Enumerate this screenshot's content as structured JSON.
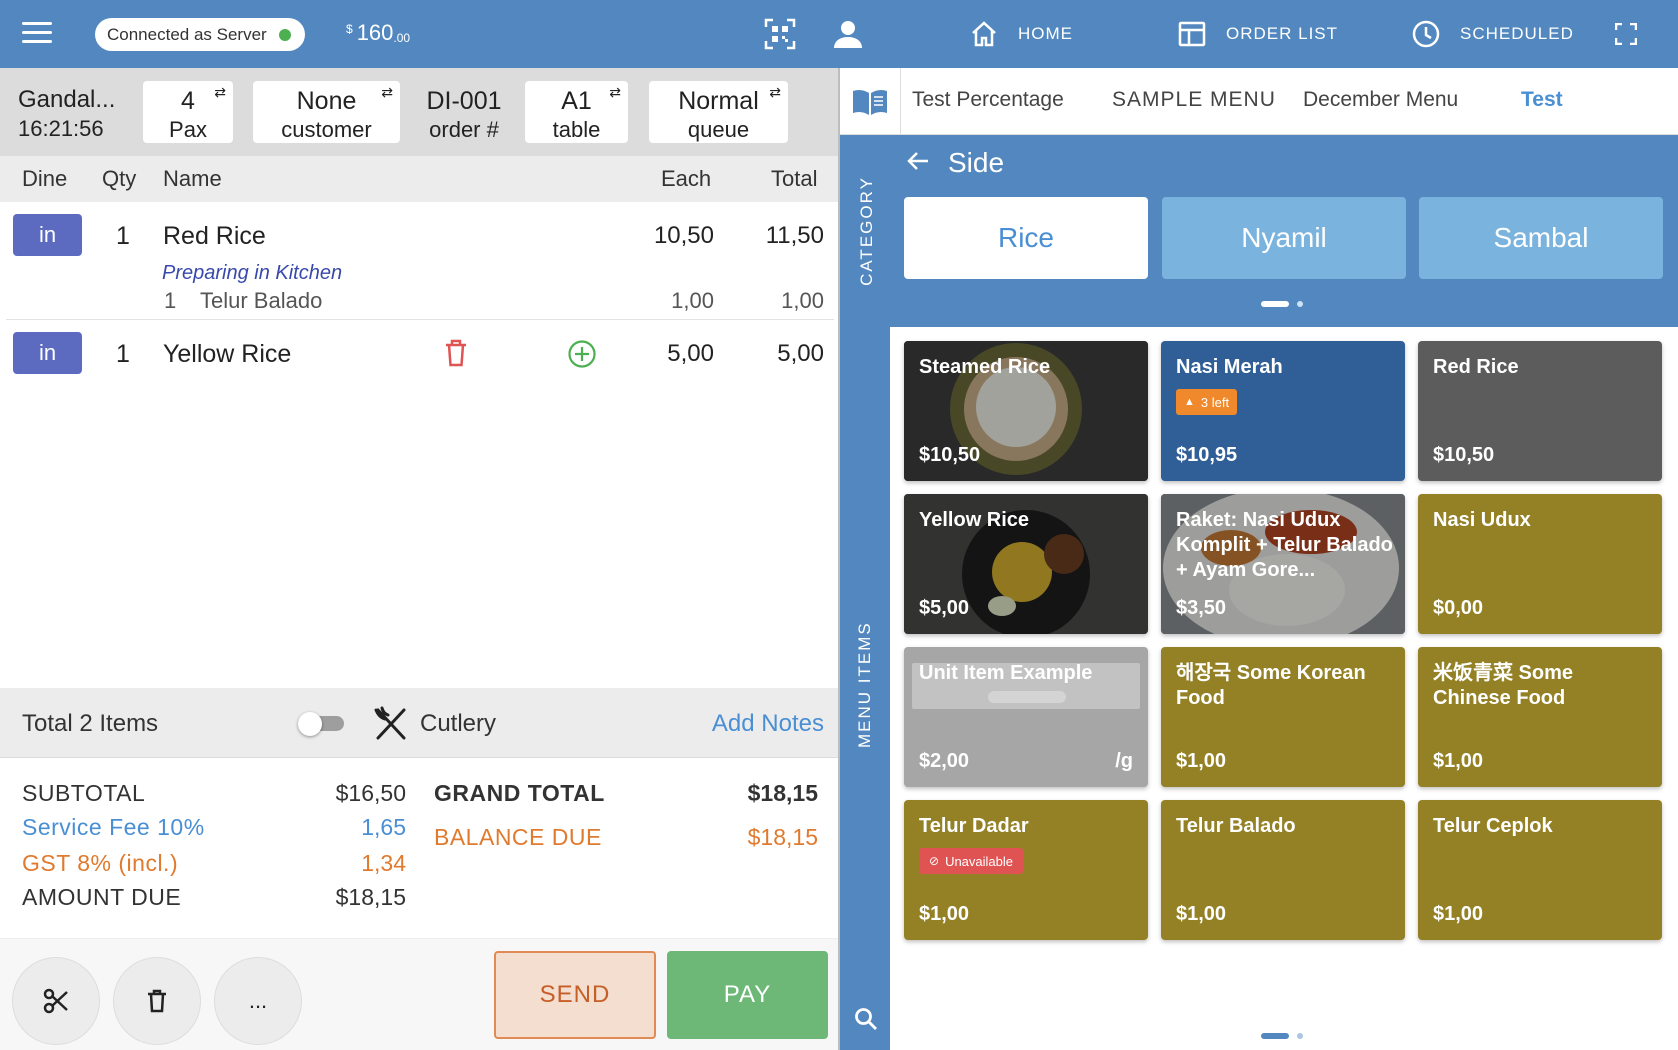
{
  "topbar": {
    "connection_label": "Connected as Server",
    "balance_currency": "$",
    "balance_whole": "160",
    "balance_cents": ".00",
    "nav": {
      "home": "HOME",
      "order_list": "ORDER LIST",
      "scheduled": "SCHEDULED"
    },
    "icons": [
      "menu-icon",
      "qr-code-icon",
      "user-icon",
      "home-icon",
      "order-list-icon",
      "clock-icon",
      "fullscreen-icon"
    ]
  },
  "order": {
    "server_name": "Gandal...",
    "time": "16:21:56",
    "pax_value": "4",
    "pax_label": "Pax",
    "customer_value": "None",
    "customer_label": "customer",
    "order_value": "DI-001",
    "order_label": "order #",
    "table_value": "A1",
    "table_label": "table",
    "queue_value": "Normal",
    "queue_label": "queue",
    "swap_glyph": "⇄"
  },
  "columns": {
    "dine": "Dine",
    "qty": "Qty",
    "name": "Name",
    "each": "Each",
    "total": "Total"
  },
  "items": [
    {
      "dine": "in",
      "qty": "1",
      "name": "Red Rice",
      "each": "10,50",
      "total": "11,50",
      "status": "Preparing in Kitchen",
      "modifier_qty": "1",
      "modifier_name": "Telur Balado",
      "modifier_each": "1,00",
      "modifier_total": "1,00"
    },
    {
      "dine": "in",
      "qty": "1",
      "name": "Yellow Rice",
      "each": "5,00",
      "total": "5,00"
    }
  ],
  "totals_bar": {
    "items_label": "Total 2 Items",
    "cutlery_label": "Cutlery",
    "cutlery_on": false,
    "add_notes": "Add Notes"
  },
  "summary": {
    "subtotal_label": "SUBTOTAL",
    "subtotal_value": "$16,50",
    "service_label": "Service Fee 10%",
    "service_value": "1,65",
    "gst_label": "GST 8%  (incl.)",
    "gst_value": "1,34",
    "amount_due_label": "AMOUNT DUE",
    "amount_due_value": "$18,15",
    "grand_total_label": "GRAND TOTAL",
    "grand_total_value": "$18,15",
    "balance_due_label": "BALANCE DUE",
    "balance_due_value": "$18,15"
  },
  "actions": {
    "more_glyph": "...",
    "send": "SEND",
    "pay": "PAY"
  },
  "menus": {
    "tabs": [
      "Test Percentage",
      "SAMPLE MENU",
      "December Menu",
      "Test"
    ],
    "active_index": 3
  },
  "category": {
    "side_label": "CATEGORY",
    "title": "Side",
    "buttons": [
      "Rice",
      "Nyamil",
      "Sambal"
    ],
    "selected_index": 0
  },
  "menu_items": {
    "side_label": "MENU ITEMS",
    "tiles": [
      {
        "name": "Steamed Rice",
        "price": "$10,50",
        "style": "photo-rice"
      },
      {
        "name": "Nasi Merah",
        "price": "$10,95",
        "style": "navy",
        "badge": "3 left"
      },
      {
        "name": "Red Rice",
        "price": "$10,50",
        "style": "graydk"
      },
      {
        "name": "Yellow Rice",
        "price": "$5,00",
        "style": "photo-yellow"
      },
      {
        "name": "Raket: Nasi Udux Komplit + Telur Balado + Ayam Gore...",
        "price": "$3,50",
        "style": "photo-udux"
      },
      {
        "name": "Nasi Udux",
        "price": "$0,00",
        "style": "gold"
      },
      {
        "name": "Unit Item Example",
        "price": "$2,00",
        "unit": "/g",
        "style": "graylt"
      },
      {
        "name": "해장국 Some Korean Food",
        "price": "$1,00",
        "style": "gold"
      },
      {
        "name": "米饭青菜 Some Chinese Food",
        "price": "$1,00",
        "style": "gold"
      },
      {
        "name": "Telur Dadar",
        "price": "$1,00",
        "style": "gold",
        "unavailable": "Unavailable"
      },
      {
        "name": "Telur Balado",
        "price": "$1,00",
        "style": "gold"
      },
      {
        "name": "Telur Ceplok",
        "price": "$1,00",
        "style": "gold"
      }
    ]
  },
  "colors": {
    "brand_blue": "#5288bf",
    "dine_in": "#5c6bc0",
    "tile_gold": "#948125",
    "tile_navy": "#2f5f96",
    "pay_green": "#6db877",
    "send_orange": "#e08a56"
  }
}
